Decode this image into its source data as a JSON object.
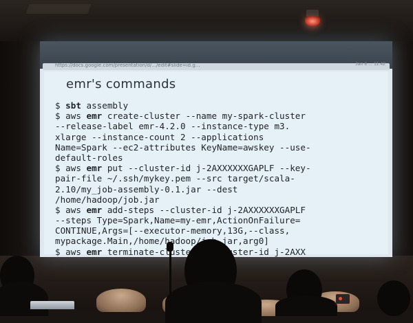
{
  "scene": {
    "description_type": "photo-of-projected-slide"
  },
  "browser": {
    "url": "https://docs.google.com/presentation/d/.../edit#slide=id.g...",
    "tray": "Jan 8 ... 11:42"
  },
  "slide": {
    "title": "emr's commands",
    "lines": [
      [
        {
          "t": "$ "
        },
        {
          "t": "sbt",
          "b": true
        },
        {
          "t": " assembly"
        }
      ],
      [
        {
          "t": "$ aws "
        },
        {
          "t": "emr",
          "b": true
        },
        {
          "t": " create-cluster --name my-spark-cluster"
        }
      ],
      [
        {
          "t": "--release-label emr-4.2.0 --instance-type m3."
        }
      ],
      [
        {
          "t": "xlarge --instance-count 2 --applications"
        }
      ],
      [
        {
          "t": "Name=Spark --ec2-attributes KeyName=awskey --use-"
        }
      ],
      [
        {
          "t": "default-roles"
        }
      ],
      [
        {
          "t": "$ aws "
        },
        {
          "t": "emr",
          "b": true
        },
        {
          "t": " put --cluster-id j-2AXXXXXXGAPLF --key-"
        }
      ],
      [
        {
          "t": "pair-file ~/.ssh/mykey.pem --src target/scala-"
        }
      ],
      [
        {
          "t": "2.10/my_job-assembly-0.1.jar --dest"
        }
      ],
      [
        {
          "t": "/home/hadoop/job.jar"
        }
      ],
      [
        {
          "t": "$ aws "
        },
        {
          "t": "emr",
          "b": true
        },
        {
          "t": " add-steps --cluster-id j-2AXXXXXXGAPLF"
        }
      ],
      [
        {
          "t": "--steps Type=Spark,Name=my-emr,ActionOnFailure="
        }
      ],
      [
        {
          "t": "CONTINUE,Args=[--executor-memory,13G,--class,"
        }
      ],
      [
        {
          "t": "mypackage.Main,/home/hadoop/job.jar,arg0]"
        }
      ],
      [
        {
          "t": "$ aws "
        },
        {
          "t": "emr",
          "b": true
        },
        {
          "t": " terminate-clusters --cluster-id j-2AXX"
        }
      ]
    ]
  }
}
